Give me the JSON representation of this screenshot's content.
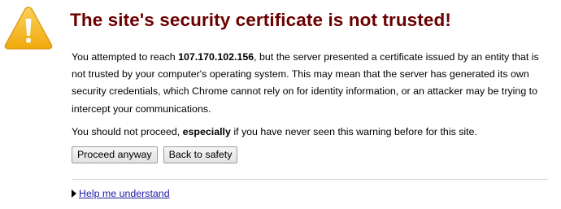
{
  "heading": {
    "title": "The site's security certificate is not trusted!"
  },
  "body": {
    "para1_prefix": "You attempted to reach ",
    "para1_host": "107.170.102.156",
    "para1_suffix": ", but the server presented a certificate issued by an entity that is not trusted by your computer's operating system. This may mean that the server has generated its own security credentials, which Chrome cannot rely on for identity information, or an attacker may be trying to intercept your communications.",
    "para2_prefix": "You should not proceed, ",
    "para2_emphasis": "especially",
    "para2_suffix": " if you have never seen this warning before for this site."
  },
  "buttons": {
    "proceed_label": "Proceed anyway",
    "back_label": "Back to safety"
  },
  "help": {
    "link_label": "Help me understand"
  },
  "colors": {
    "title": "#6b0000",
    "icon_fill": "#f6b51d",
    "link": "#1a1aa6"
  },
  "icons": {
    "warning": "warning-triangle-icon",
    "expand": "disclosure-triangle-icon"
  }
}
